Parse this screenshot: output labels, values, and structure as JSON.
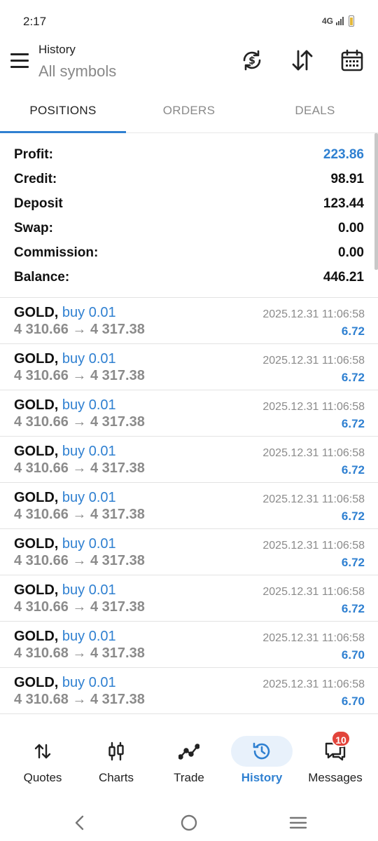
{
  "status_bar": {
    "time": "2:17",
    "network": "4G"
  },
  "app_bar": {
    "title": "History",
    "subtitle": "All symbols",
    "icons": [
      "menu-icon",
      "refresh-currency-icon",
      "sort-icon",
      "calendar-icon"
    ]
  },
  "tabs": [
    {
      "label": "POSITIONS",
      "active": true
    },
    {
      "label": "ORDERS",
      "active": false
    },
    {
      "label": "DEALS",
      "active": false
    }
  ],
  "summary": [
    {
      "label": "Profit:",
      "value": "223.86",
      "highlight": true
    },
    {
      "label": "Credit:",
      "value": "98.91",
      "highlight": false
    },
    {
      "label": "Deposit",
      "value": "123.44",
      "highlight": false
    },
    {
      "label": "Swap:",
      "value": "0.00",
      "highlight": false
    },
    {
      "label": "Commission:",
      "value": "0.00",
      "highlight": false
    },
    {
      "label": "Balance:",
      "value": "446.21",
      "highlight": false
    }
  ],
  "deals": [
    {
      "symbol": "GOLD,",
      "type": "buy 0.01",
      "prices": "4 310.66 → 4 317.38",
      "time": "2025.12.31 11:06:58",
      "profit": "6.72"
    },
    {
      "symbol": "GOLD,",
      "type": "buy 0.01",
      "prices": "4 310.66 → 4 317.38",
      "time": "2025.12.31 11:06:58",
      "profit": "6.72"
    },
    {
      "symbol": "GOLD,",
      "type": "buy 0.01",
      "prices": "4 310.66 → 4 317.38",
      "time": "2025.12.31 11:06:58",
      "profit": "6.72"
    },
    {
      "symbol": "GOLD,",
      "type": "buy 0.01",
      "prices": "4 310.66 → 4 317.38",
      "time": "2025.12.31 11:06:58",
      "profit": "6.72"
    },
    {
      "symbol": "GOLD,",
      "type": "buy 0.01",
      "prices": "4 310.66 → 4 317.38",
      "time": "2025.12.31 11:06:58",
      "profit": "6.72"
    },
    {
      "symbol": "GOLD,",
      "type": "buy 0.01",
      "prices": "4 310.66 → 4 317.38",
      "time": "2025.12.31 11:06:58",
      "profit": "6.72"
    },
    {
      "symbol": "GOLD,",
      "type": "buy 0.01",
      "prices": "4 310.66 → 4 317.38",
      "time": "2025.12.31 11:06:58",
      "profit": "6.72"
    },
    {
      "symbol": "GOLD,",
      "type": "buy 0.01",
      "prices": "4 310.68 → 4 317.38",
      "time": "2025.12.31 11:06:58",
      "profit": "6.70"
    },
    {
      "symbol": "GOLD,",
      "type": "buy 0.01",
      "prices": "4 310.68 → 4 317.38",
      "time": "2025.12.31 11:06:58",
      "profit": "6.70"
    }
  ],
  "bottom_nav": [
    {
      "label": "Quotes",
      "icon": "quotes-icon",
      "active": false
    },
    {
      "label": "Charts",
      "icon": "charts-icon",
      "active": false
    },
    {
      "label": "Trade",
      "icon": "trade-icon",
      "active": false
    },
    {
      "label": "History",
      "icon": "history-icon",
      "active": true
    },
    {
      "label": "Messages",
      "icon": "messages-icon",
      "active": false,
      "badge": "10"
    }
  ],
  "colors": {
    "accent": "#2f80d1",
    "muted": "#8b8b8b",
    "badge": "#e2443b"
  }
}
